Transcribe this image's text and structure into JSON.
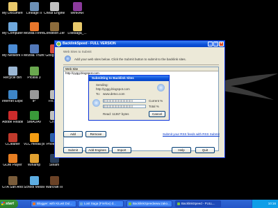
{
  "desktop": {
    "icons": [
      {
        "label": "My Documents",
        "color": "#e9c96b"
      },
      {
        "label": "Lineage II",
        "color": "#6b8fb5"
      },
      {
        "label": "Cheat Engine",
        "color": "#c0c0c0"
      },
      {
        "label": "WinRAR",
        "color": "#8b3a9c"
      },
      {
        "label": "My Computer",
        "color": "#6fa8dc"
      },
      {
        "label": "Mozilla Firefox",
        "color": "#e8762b"
      },
      {
        "label": "Condition Zero",
        "color": "#8c6b3b"
      },
      {
        "label": "Lostsaga_...",
        "color": "#e9c96b"
      },
      {
        "label": "My Network Places",
        "color": "#4b8bd4"
      },
      {
        "label": "Mozilla Thunderbird",
        "color": "#5278b8"
      },
      {
        "label": "Google C...",
        "color": "#d44a3a"
      },
      {
        "label": "Recycle Bin",
        "color": "#9bb7d4"
      },
      {
        "label": "Picasa 3",
        "color": "#6aa84f"
      },
      {
        "label": "Internet Explorer",
        "color": "#3d85c6"
      },
      {
        "label": "IP",
        "color": "#999999"
      },
      {
        "label": "FR.exe",
        "color": "#bbbbbb"
      },
      {
        "label": "Adobe Reader 9",
        "color": "#cc2b2b"
      },
      {
        "label": "SMADAV",
        "color": "#3a9a3a"
      },
      {
        "label": "Cheat",
        "color": "#c0c0c0"
      },
      {
        "label": "CCleaner",
        "color": "#c0392b"
      },
      {
        "label": "VLC media player",
        "color": "#f39c12"
      },
      {
        "label": "Photosh...",
        "color": "#2c5fa8"
      },
      {
        "label": "GOM Player",
        "color": "#e67e22"
      },
      {
        "label": "Winamp",
        "color": "#e0a030"
      },
      {
        "label": "Steam",
        "color": "#2a3f5a"
      },
      {
        "label": "GTA San Andreas",
        "color": "#7a5c3a"
      },
      {
        "label": "School Messenger",
        "color": "#5dade2"
      },
      {
        "label": "Warcraft III",
        "color": "#6b4226"
      }
    ]
  },
  "main_window": {
    "title": "BacklinkSpeed - FULL VERSION",
    "header_label": "Web Sites to Submit",
    "description": "Add your web sites below. Click the Submit button to submit to the backlink sites.",
    "column_header": "Web Site",
    "rows": [
      "http://yygg.blogspot.com"
    ],
    "add_label": "Add",
    "remove_label": "Remove",
    "rss_link": "Submit your RSS feeds with RSS Submit",
    "submit_label": "Submit",
    "add_engines_label": "Add Engines",
    "import_label": "Import",
    "help_label": "Help",
    "quit_label": "Quit"
  },
  "submit_dialog": {
    "title": "Submitting to Backlink Sites",
    "sending_label": "Sending:",
    "sending_value": "http://yygg.blogspot.com",
    "to_label": "To:",
    "to_value": "www.detvo.com",
    "current_label": "Current %",
    "total_label": "Total %",
    "current_percent": 0.7,
    "total_percent": 0.7,
    "read_text": "Read: 11367 bytes",
    "cancel_label": "Cancel"
  },
  "taskbar": {
    "start_label": "start",
    "tasks": [
      {
        "label": "Blogger: with KiLwit Dul...",
        "color": "#e8762b"
      },
      {
        "label": "Lost Saga (Firefox) d...",
        "color": "#6fa8dc"
      },
      {
        "label": "BacklinkSpeedwww.zako...",
        "color": "#7bc043"
      },
      {
        "label": "BacklinkSpeed - FULL...",
        "color": "#7bc043",
        "active": true
      }
    ],
    "clock": "10:16"
  }
}
